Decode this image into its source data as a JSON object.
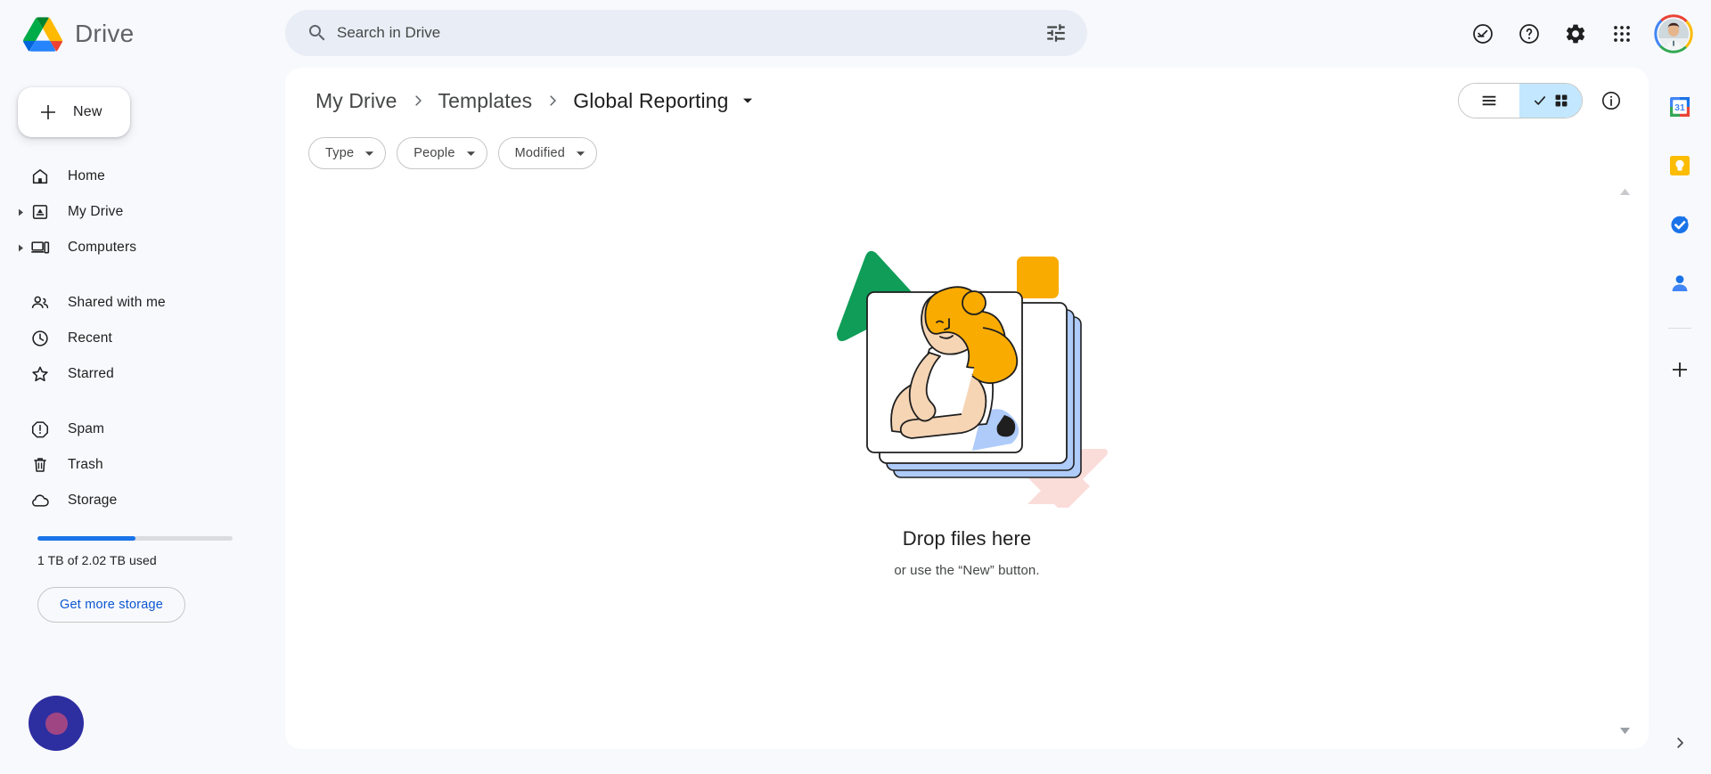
{
  "app": {
    "brand_name": "Drive",
    "logo_icon": "google-drive-logo"
  },
  "search": {
    "placeholder": "Search in Drive",
    "value": "",
    "icon": "search-icon",
    "options_icon": "tune-options-icon"
  },
  "header_actions": [
    {
      "name": "active-status-icon",
      "label": "Active"
    },
    {
      "name": "help-icon",
      "label": "Support"
    },
    {
      "name": "gear-icon",
      "label": "Settings"
    },
    {
      "name": "apps-grid-icon",
      "label": "Google apps"
    }
  ],
  "account": {
    "avatar_name": "avatar",
    "ring_colors": [
      "#ea4335",
      "#fbbc04",
      "#34a853",
      "#4285f4"
    ]
  },
  "sidebar": {
    "new_button": {
      "label": "New",
      "icon": "plus-icon"
    },
    "groups": [
      {
        "items": [
          {
            "label": "Home",
            "icon": "home-icon",
            "expandable": false
          },
          {
            "label": "My Drive",
            "icon": "my-drive-icon",
            "expandable": true
          },
          {
            "label": "Computers",
            "icon": "computers-icon",
            "expandable": true
          }
        ]
      },
      {
        "items": [
          {
            "label": "Shared with me",
            "icon": "people-icon",
            "expandable": false
          },
          {
            "label": "Recent",
            "icon": "clock-icon",
            "expandable": false
          },
          {
            "label": "Starred",
            "icon": "star-icon",
            "expandable": false
          }
        ]
      },
      {
        "items": [
          {
            "label": "Spam",
            "icon": "spam-icon",
            "expandable": false
          },
          {
            "label": "Trash",
            "icon": "trash-icon",
            "expandable": false
          },
          {
            "label": "Storage",
            "icon": "cloud-icon",
            "expandable": false
          }
        ]
      }
    ],
    "storage": {
      "used_percent": 50,
      "text": "1 TB of 2.02 TB used",
      "button_label": "Get more storage",
      "bar_color": "#1a73e8",
      "track_color": "#dadce0"
    }
  },
  "breadcrumb": {
    "items": [
      {
        "label": "My Drive",
        "current": false
      },
      {
        "label": "Templates",
        "current": false
      },
      {
        "label": "Global Reporting",
        "current": true
      }
    ],
    "separator_icon": "chevron-right-icon",
    "dropdown_icon": "caret-down-icon"
  },
  "filters": [
    {
      "label": "Type",
      "icon": "caret-down-icon"
    },
    {
      "label": "People",
      "icon": "caret-down-icon"
    },
    {
      "label": "Modified",
      "icon": "caret-down-icon"
    }
  ],
  "view_toggle": {
    "list": {
      "name": "list-view-button",
      "icon": "list-view-icon",
      "active": false
    },
    "grid": {
      "name": "grid-view-button",
      "icon": "grid-view-icon",
      "active": true
    },
    "active_color": "#c2e7ff",
    "check_icon": "check-icon"
  },
  "info_button": {
    "name": "details-info-button",
    "icon": "info-icon"
  },
  "empty_state": {
    "title": "Drop files here",
    "subtitle": "or use the “New” button.",
    "illustration": "person-with-cards-illustration",
    "colors": {
      "green_triangle": "#0f9d58",
      "yellow_square": "#f9ab00",
      "pink_diamond": "#fadcd9",
      "blue_card": "#aecbfa",
      "hair": "#f9ab00",
      "skin": "#f6d5b5"
    }
  },
  "scroll": {
    "up_icon": "scroll-up-arrow-icon",
    "down_icon": "scroll-down-arrow-icon"
  },
  "right_rail": {
    "items": [
      {
        "name": "google-calendar-icon",
        "label": "Calendar"
      },
      {
        "name": "google-keep-icon",
        "label": "Keep"
      },
      {
        "name": "google-tasks-icon",
        "label": "Tasks"
      },
      {
        "name": "google-contacts-icon",
        "label": "Contacts"
      }
    ],
    "add_label": "Get add-ons",
    "add_icon": "plus-icon",
    "expand_icon": "chevron-right-icon"
  },
  "cursor_badge": {
    "name": "cursor-indicator",
    "outer_color": "#2d2ea0",
    "inner_color": "#b5497f"
  }
}
